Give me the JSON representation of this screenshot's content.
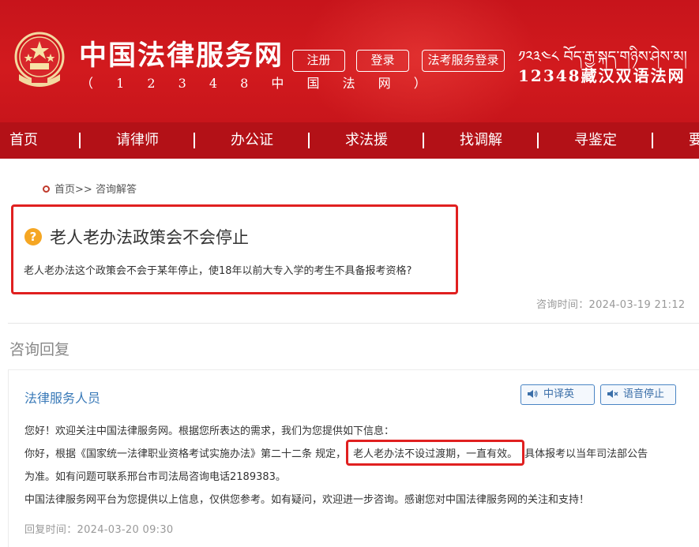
{
  "header": {
    "site_title": "中国法律服务网",
    "site_subtitle": "（ 1 2 3 4 8 中 国 法 网 ）",
    "register_label": "注册",
    "login_label": "登录",
    "exam_service_label": "法考服务登录",
    "tibetan_text": "༡༢༣༤༨ བོད་རྒྱ་སྐད་གཉིས་ཤེས་མ།",
    "bilingual_label": "12348藏汉双语法网",
    "emblem_icon": "national-emblem-icon"
  },
  "nav": {
    "items": [
      "首页",
      "请律师",
      "办公证",
      "求法援",
      "找调解",
      "寻鉴定",
      "要"
    ]
  },
  "breadcrumb": {
    "home": "首页",
    "sep": ">>",
    "current": "咨询解答"
  },
  "question": {
    "icon": "question-mark-icon",
    "title": "老人老办法政策会不会停止",
    "body": "老人老办法这个政策会不会于某年停止，使18年以前大专入学的考生不具备报考资格?",
    "time_label": "咨询时间：",
    "time": "2024-03-19 21:12"
  },
  "reply_section": {
    "title": "咨询回复"
  },
  "reply": {
    "replier": "法律服务人员",
    "translate_label": "中译英",
    "stop_voice_label": "语音停止",
    "line1": "您好！欢迎关注中国法律服务网。根据您所表达的需求，我们为您提供如下信息：",
    "line2_prefix": "你好，根据《国家统一法律职业资格考试实施办法》第二十二条 规定，",
    "line2_highlight": "老人老办法不设过渡期，一直有效。",
    "line2_suffix": "具体报考以当年司法部公告",
    "line3": "为准。如有问题可联系邢台市司法局咨询电话2189383。",
    "line4": "中国法律服务网平台为您提供以上信息，仅供您参考。如有疑问，欢迎进一步咨询。感谢您对中国法律服务网的关注和支持！",
    "time_label": "回复时间：",
    "time": "2024-03-20 09:30"
  },
  "colors": {
    "header_red": "#c7141b",
    "nav_red": "#b31117",
    "highlight_red": "#e02020",
    "link_blue": "#3a7ab8"
  }
}
